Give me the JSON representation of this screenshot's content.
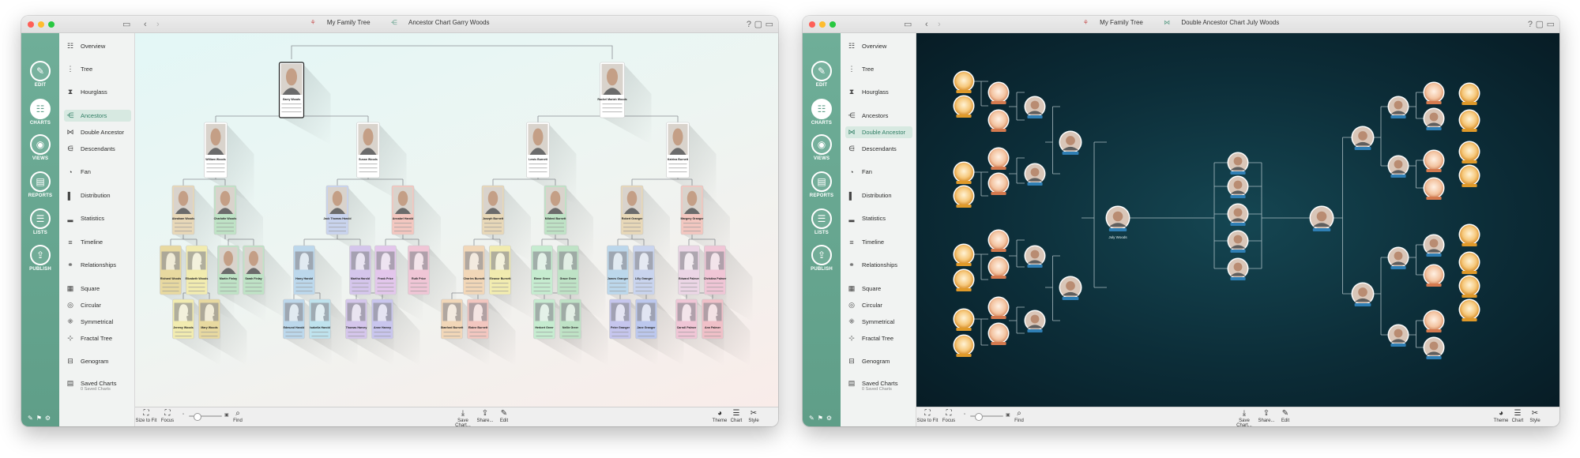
{
  "left_window": {
    "breadcrumb": {
      "tree": "My Family Tree",
      "chart": "Ancestor Chart Garry Woods"
    },
    "rail": [
      {
        "label": "EDIT",
        "icon": "pencil-icon",
        "active": false
      },
      {
        "label": "CHARTS",
        "icon": "charts-icon",
        "active": true
      },
      {
        "label": "VIEWS",
        "icon": "eye-icon",
        "active": false
      },
      {
        "label": "REPORTS",
        "icon": "report-icon",
        "active": false
      },
      {
        "label": "LISTS",
        "icon": "list-icon",
        "active": false
      },
      {
        "label": "PUBLISH",
        "icon": "publish-icon",
        "active": false
      }
    ],
    "menu": [
      {
        "label": "Overview",
        "icon": "overview-icon"
      },
      {
        "label": "Tree",
        "icon": "tree-icon"
      },
      {
        "label": "Hourglass",
        "icon": "hourglass-icon"
      },
      {
        "label": "Ancestors",
        "icon": "ancestors-icon",
        "selected": true
      },
      {
        "label": "Double Ancestor",
        "icon": "double-ancestor-icon"
      },
      {
        "label": "Descendants",
        "icon": "descendants-icon"
      },
      {
        "label": "Fan",
        "icon": "fan-icon"
      },
      {
        "label": "Distribution",
        "icon": "distribution-icon"
      },
      {
        "label": "Statistics",
        "icon": "statistics-icon"
      },
      {
        "label": "Timeline",
        "icon": "timeline-icon"
      },
      {
        "label": "Relationships",
        "icon": "relationships-icon"
      },
      {
        "label": "Square",
        "icon": "square-icon"
      },
      {
        "label": "Circular",
        "icon": "circular-icon"
      },
      {
        "label": "Symmetrical",
        "icon": "symmetrical-icon"
      },
      {
        "label": "Fractal Tree",
        "icon": "fractal-tree-icon"
      },
      {
        "label": "Genogram",
        "icon": "genogram-icon"
      },
      {
        "label": "Saved Charts",
        "icon": "saved-charts-icon",
        "sub": "0 Saved Charts"
      }
    ],
    "toolbar": {
      "size_to_fit": "Size to Fit",
      "focus": "Focus",
      "find": "Find",
      "save_chart": "Save Chart...",
      "share": "Share...",
      "edit": "Edit",
      "theme": "Theme",
      "chart": "Chart",
      "style": "Style"
    }
  },
  "right_window": {
    "breadcrumb": {
      "tree": "My Family Tree",
      "chart": "Double Ancestor Chart July Woods"
    },
    "rail": [
      {
        "label": "EDIT",
        "icon": "pencil-icon",
        "active": false
      },
      {
        "label": "CHARTS",
        "icon": "charts-icon",
        "active": true
      },
      {
        "label": "VIEWS",
        "icon": "eye-icon",
        "active": false
      },
      {
        "label": "REPORTS",
        "icon": "report-icon",
        "active": false
      },
      {
        "label": "LISTS",
        "icon": "list-icon",
        "active": false
      },
      {
        "label": "PUBLISH",
        "icon": "publish-icon",
        "active": false
      }
    ],
    "menu": [
      {
        "label": "Overview",
        "icon": "overview-icon"
      },
      {
        "label": "Tree",
        "icon": "tree-icon"
      },
      {
        "label": "Hourglass",
        "icon": "hourglass-icon"
      },
      {
        "label": "Ancestors",
        "icon": "ancestors-icon"
      },
      {
        "label": "Double Ancestor",
        "icon": "double-ancestor-icon",
        "selected": true
      },
      {
        "label": "Descendants",
        "icon": "descendants-icon"
      },
      {
        "label": "Fan",
        "icon": "fan-icon"
      },
      {
        "label": "Distribution",
        "icon": "distribution-icon"
      },
      {
        "label": "Statistics",
        "icon": "statistics-icon"
      },
      {
        "label": "Timeline",
        "icon": "timeline-icon"
      },
      {
        "label": "Relationships",
        "icon": "relationships-icon"
      },
      {
        "label": "Square",
        "icon": "square-icon"
      },
      {
        "label": "Circular",
        "icon": "circular-icon"
      },
      {
        "label": "Symmetrical",
        "icon": "symmetrical-icon"
      },
      {
        "label": "Fractal Tree",
        "icon": "fractal-tree-icon"
      },
      {
        "label": "Genogram",
        "icon": "genogram-icon"
      },
      {
        "label": "Saved Charts",
        "icon": "saved-charts-icon",
        "sub": "0 Saved Charts"
      }
    ],
    "toolbar": {
      "size_to_fit": "Size to Fit",
      "focus": "Focus",
      "find": "Find",
      "save_chart": "Save Chart...",
      "share": "Share...",
      "edit": "Edit",
      "theme": "Theme",
      "chart": "Chart",
      "style": "Style"
    }
  },
  "ancestor_chart": {
    "generations": [
      [
        {
          "name": "Garry Woods",
          "photo": true
        },
        {
          "name": "Rachel Mariah Woods",
          "photo": true
        }
      ],
      [
        {
          "name": "William Woods",
          "photo": true
        },
        {
          "name": "Susan Woods",
          "photo": true
        },
        {
          "name": "Lewis Burnett",
          "photo": true
        },
        {
          "name": "Katrina Burnett",
          "photo": true
        }
      ],
      [
        {
          "name": "Abraham Woods",
          "photo": true,
          "color": "#e8d8b8"
        },
        {
          "name": "Charlotte Woods",
          "photo": true,
          "color": "#bfe3c6"
        },
        {
          "name": "Jack Thomas Harold",
          "photo": true,
          "color": "#c9d4ee"
        },
        {
          "name": "Annabel Harold",
          "photo": true,
          "color": "#f3c7c0"
        },
        {
          "name": "Joseph Burnett",
          "photo": true,
          "color": "#e8d8b8"
        },
        {
          "name": "Mildred Burnett",
          "photo": true,
          "color": "#bfe3c6"
        },
        {
          "name": "Robert Granger",
          "photo": true,
          "color": "#e8d8b8"
        },
        {
          "name": "Margery Granger",
          "photo": true,
          "color": "#f3c7c0"
        }
      ],
      [
        {
          "name": "Richard Woods",
          "photo": false,
          "color": "#e8d9a0"
        },
        {
          "name": "Elizabeth Woods",
          "photo": false,
          "color": "#f2ecb0"
        },
        {
          "name": "Martin Finlay",
          "photo": true,
          "color": "#bfe3c6"
        },
        {
          "name": "Sarah Finlay",
          "photo": true,
          "color": "#bfe3c6"
        },
        {
          "name": "Harry Harold",
          "photo": false,
          "color": "#bcd8ec"
        },
        {
          "name": "Martha Harold",
          "photo": false,
          "color": "#d5c6ec"
        },
        {
          "name": "Frank Price",
          "photo": false,
          "color": "#e3c7ec"
        },
        {
          "name": "Ruth Price",
          "photo": false,
          "color": "#f0c6d6"
        },
        {
          "name": "Charles Burnett",
          "photo": false,
          "color": "#f2d7b8"
        },
        {
          "name": "Eleanor Burnett",
          "photo": false,
          "color": "#f2ecb0"
        },
        {
          "name": "Elmer Greer",
          "photo": false,
          "color": "#c6ecd0"
        },
        {
          "name": "Grace Greer",
          "photo": false,
          "color": "#bfe3c6"
        },
        {
          "name": "James Granger",
          "photo": false,
          "color": "#bcd8ec"
        },
        {
          "name": "Lilly Granger",
          "photo": false,
          "color": "#c9d4ee"
        },
        {
          "name": "Edward Palmer",
          "photo": false,
          "color": "#ecd6e6"
        },
        {
          "name": "Christina Palmer",
          "photo": false,
          "color": "#f0c6d6"
        }
      ],
      [
        {
          "name": "Jeremy Woods",
          "photo": false,
          "color": "#f2ecb0"
        },
        {
          "name": "Mary Woods",
          "photo": false,
          "color": "#e8d9a0"
        },
        {
          "name": "Edmund Harold",
          "photo": false,
          "color": "#bcd8ec"
        },
        {
          "name": "Isabella Harold",
          "photo": false,
          "color": "#bfe3ee"
        },
        {
          "name": "Thomas Harvey",
          "photo": false,
          "color": "#d5c6ec"
        },
        {
          "name": "Anne Harvey",
          "photo": false,
          "color": "#c9c6ee"
        },
        {
          "name": "Stanford Burnett",
          "photo": false,
          "color": "#f2d7b8"
        },
        {
          "name": "Elaine Burnett",
          "photo": false,
          "color": "#f3c7c0"
        },
        {
          "name": "Herbert Greer",
          "photo": false,
          "color": "#c6ecd0"
        },
        {
          "name": "Nellie Greer",
          "photo": false,
          "color": "#bfe3c6"
        },
        {
          "name": "Peter Granger",
          "photo": false,
          "color": "#c6c6ee"
        },
        {
          "name": "Jane Granger",
          "photo": false,
          "color": "#bcc8ee"
        },
        {
          "name": "Carroll Palmer",
          "photo": false,
          "color": "#f0c6d6"
        },
        {
          "name": "Ann Palmer",
          "photo": false,
          "color": "#f0c0c8"
        }
      ]
    ]
  },
  "double_ancestor_chart": {
    "center": {
      "name": "July Woods",
      "photo": true
    },
    "siblings_note": "5 children in the centre column"
  }
}
